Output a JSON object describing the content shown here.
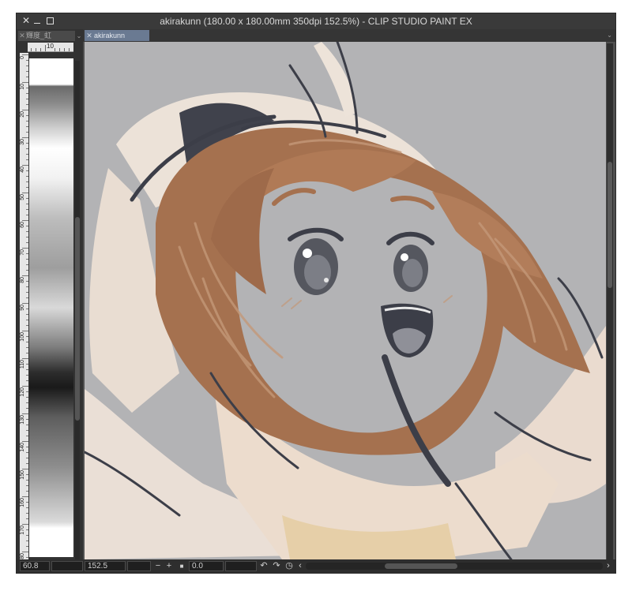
{
  "window": {
    "title": "akirakunn (180.00 x 180.00mm 350dpi 152.5%)  - CLIP STUDIO PAINT EX",
    "close_glyph": "✕"
  },
  "left_panel": {
    "tab_label": "輝度_虹",
    "tab_close_glyph": "✕",
    "menu_glyph": "⌄",
    "ruler_top_label": "10",
    "ruler_side_labels": [
      "0",
      "10",
      "20",
      "30",
      "40",
      "50",
      "60",
      "70",
      "80",
      "90",
      "100",
      "110",
      "120",
      "130",
      "140",
      "150",
      "160",
      "170",
      "180"
    ]
  },
  "document": {
    "tab_label": "akirakunn",
    "tab_close_glyph": "✕",
    "menu_glyph": "⌄"
  },
  "statusbar": {
    "left_value": "60.8",
    "zoom_value": "152.5",
    "zoom_out_glyph": "−",
    "zoom_in_glyph": "+",
    "stop_glyph": "■",
    "rotation_value": "0.0",
    "rotate_left_glyph": "↶",
    "rotate_right_glyph": "↷",
    "reset_glyph": "◷",
    "scroll_left_glyph": "‹",
    "scroll_right_glyph": "›"
  },
  "colors": {
    "canvas_background": "#b3b3b5",
    "hair": "#a5714f",
    "hair_light": "#c49878",
    "skin": "#ead8cc",
    "dark_line": "#3c3e48",
    "coat": "#eddfd2",
    "tab_active": "#6a7a92"
  }
}
